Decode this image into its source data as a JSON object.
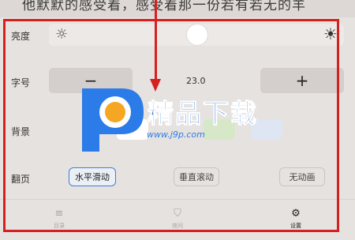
{
  "top_text": "他默默的感受着，感受着那一份若有若无的羊",
  "settings": {
    "brightness": {
      "label": "亮度",
      "level": 0.5,
      "low_icon": "sun-low-icon",
      "high_icon": "sun-high-icon"
    },
    "font_size": {
      "label": "字号",
      "minus_label": "−",
      "plus_label": "+",
      "value": "23.0"
    },
    "background": {
      "label": "背景",
      "swatches": [
        "#ffffff",
        "#d6e8c8",
        "#dde6f2"
      ]
    },
    "page_turn": {
      "label": "翻页",
      "options": [
        "水平滑动",
        "垂直滚动",
        "无动画"
      ],
      "selected": "水平滑动"
    }
  },
  "tabbar": {
    "items": [
      {
        "label": "目录",
        "icon": "list-icon"
      },
      {
        "label": "夜间",
        "icon": "night-shield-icon"
      },
      {
        "label": "设置",
        "icon": "gear-icon",
        "active": true
      }
    ]
  },
  "watermark": {
    "title": "精品下载",
    "url": "www.j9p.com"
  },
  "colors": {
    "highlight": "#d62020",
    "accent": "#3f7fd6",
    "watermark_blue": "#2b7be8"
  }
}
